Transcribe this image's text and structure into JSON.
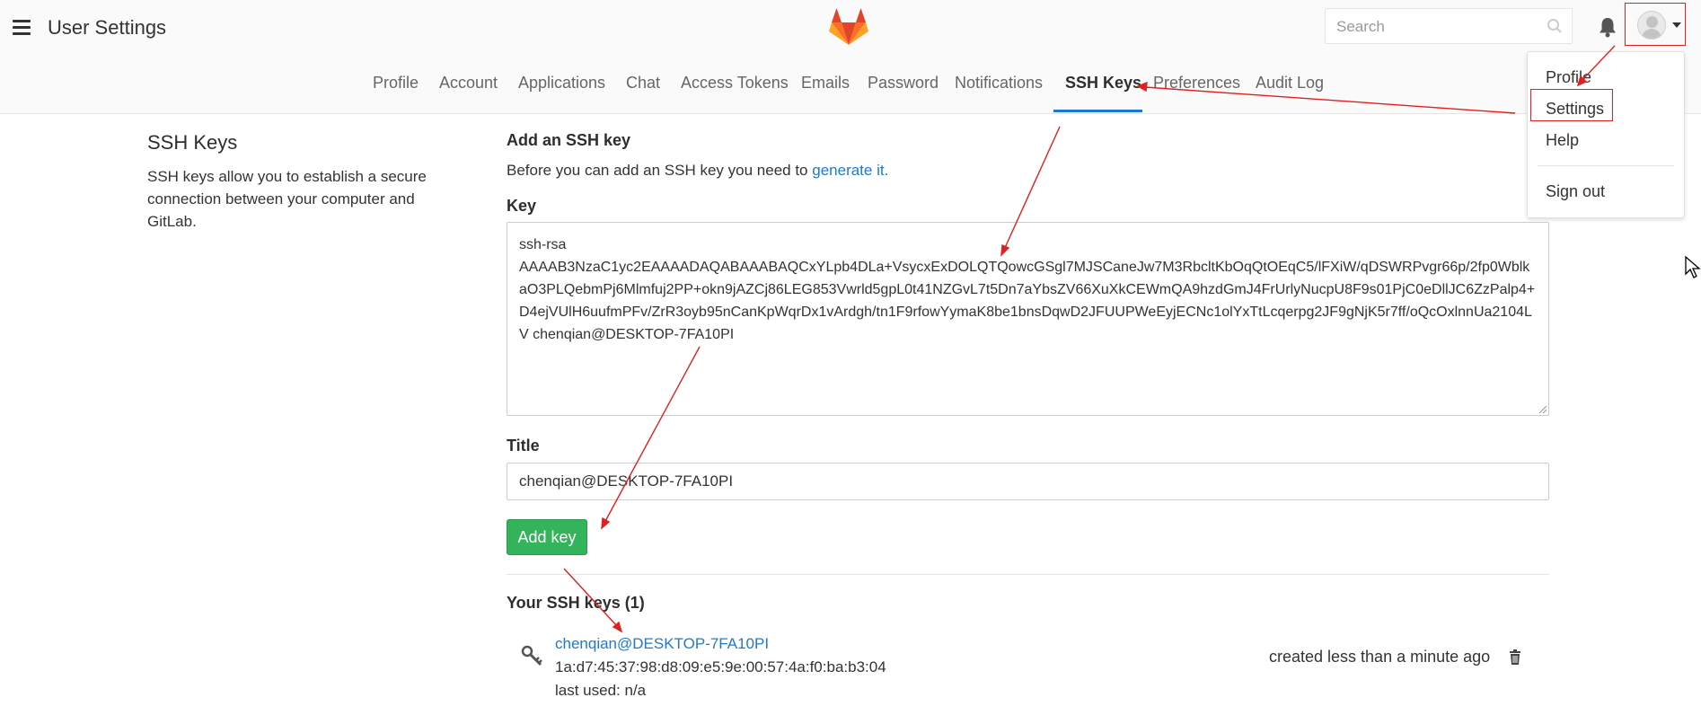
{
  "header": {
    "title": "User Settings",
    "search_placeholder": "Search",
    "menu_icon": "hamburger-icon",
    "logo_icon": "gitlab-fox-logo",
    "bell_icon": "bell-icon",
    "search_icon": "search-icon"
  },
  "nav": {
    "items": [
      "Profile",
      "Account",
      "Applications",
      "Chat",
      "Access Tokens",
      "Emails",
      "Password",
      "Notifications",
      "SSH Keys",
      "Preferences",
      "Audit Log"
    ],
    "active": "SSH Keys"
  },
  "user_menu": {
    "items": [
      "Profile",
      "Settings",
      "Help",
      "Sign out"
    ]
  },
  "sidebar": {
    "title": "SSH Keys",
    "description": "SSH keys allow you to establish a secure connection between your computer and GitLab."
  },
  "form": {
    "heading": "Add an SSH key",
    "intro_text": "Before you can add an SSH key you need to",
    "intro_link": "generate it.",
    "key_label": "Key",
    "key_value_line1": "ssh-rsa",
    "key_value_rest": "AAAAB3NzaC1yc2EAAAADAQABAAABAQCxYLpb4DLa+VsycxExDOLQTQowcGSgl7MJSCaneJw7M3RbcltKbOqQtOEqC5/lFXiW/qDSWRPvgr66p/2fp0WblkaO3PLQebmPj6Mlmfuj2PP+okn9jAZCj86LEG853Vwrld5gpL0t41NZGvL7t5Dn7aYbsZV66XuXkCEWmQA9hzdGmJ4FrUrlyNucpU8F9s01PjC0eDllJC6ZzPalp4+D4ejVUlH6uufmPFv/ZrR3oyb95nCanKpWqrDx1vArdgh/tn1F9rfowYymaK8be1bnsDqwD2JFUUPWeEyjECNc1olYxTtLcqerpg2JF9gNjK5r7ff/oQcOxlnnUa2104LV chenqian@DESKTOP-7FA10PI",
    "title_label": "Title",
    "title_value": "chenqian@DESKTOP-7FA10PI",
    "submit_label": "Add key"
  },
  "keys": {
    "heading": "Your SSH keys (1)",
    "list": [
      {
        "title": "chenqian@DESKTOP-7FA10PI",
        "fingerprint": "1a:d7:45:37:98:d8:09:e5:9e:00:57:4a:f0:ba:b3:04",
        "last_used": "last used: n/a",
        "created": "created less than a minute ago"
      }
    ]
  },
  "colors": {
    "accent": "#1f78d1",
    "button_green": "#33b35a",
    "annotation_red": "#e0201e"
  }
}
